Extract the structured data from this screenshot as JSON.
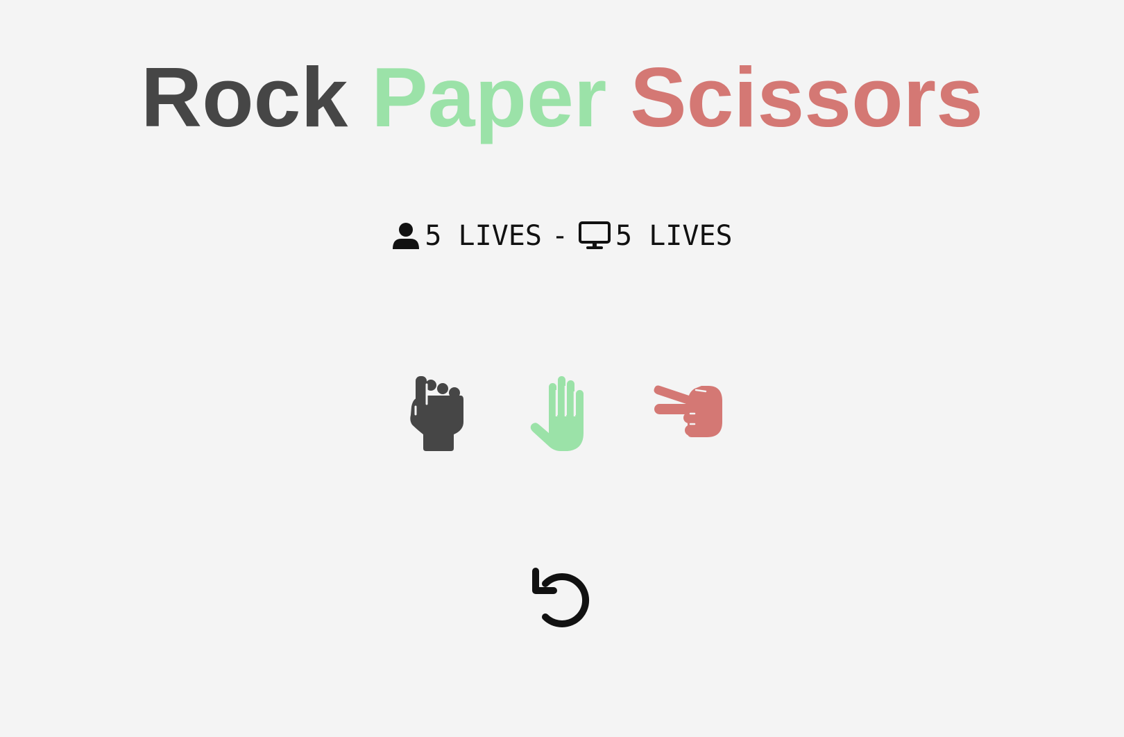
{
  "title": {
    "rock": "Rock",
    "paper": "Paper",
    "scissors": "Scissors"
  },
  "score": {
    "player_icon": "user-icon",
    "player_lives": "5 LIVES",
    "separator": "-",
    "computer_icon": "desktop-icon",
    "computer_lives": "5 LIVES"
  },
  "choices": [
    {
      "name": "rock",
      "icon": "hand-rock-icon",
      "color": "#464646"
    },
    {
      "name": "paper",
      "icon": "hand-paper-icon",
      "color": "#9be2a8"
    },
    {
      "name": "scissors",
      "icon": "hand-scissors-icon",
      "color": "#d47874"
    }
  ],
  "reset": {
    "icon": "reset-icon"
  },
  "colors": {
    "background": "#f4f4f4",
    "rock": "#464646",
    "paper": "#9be2a8",
    "scissors": "#d47874"
  }
}
